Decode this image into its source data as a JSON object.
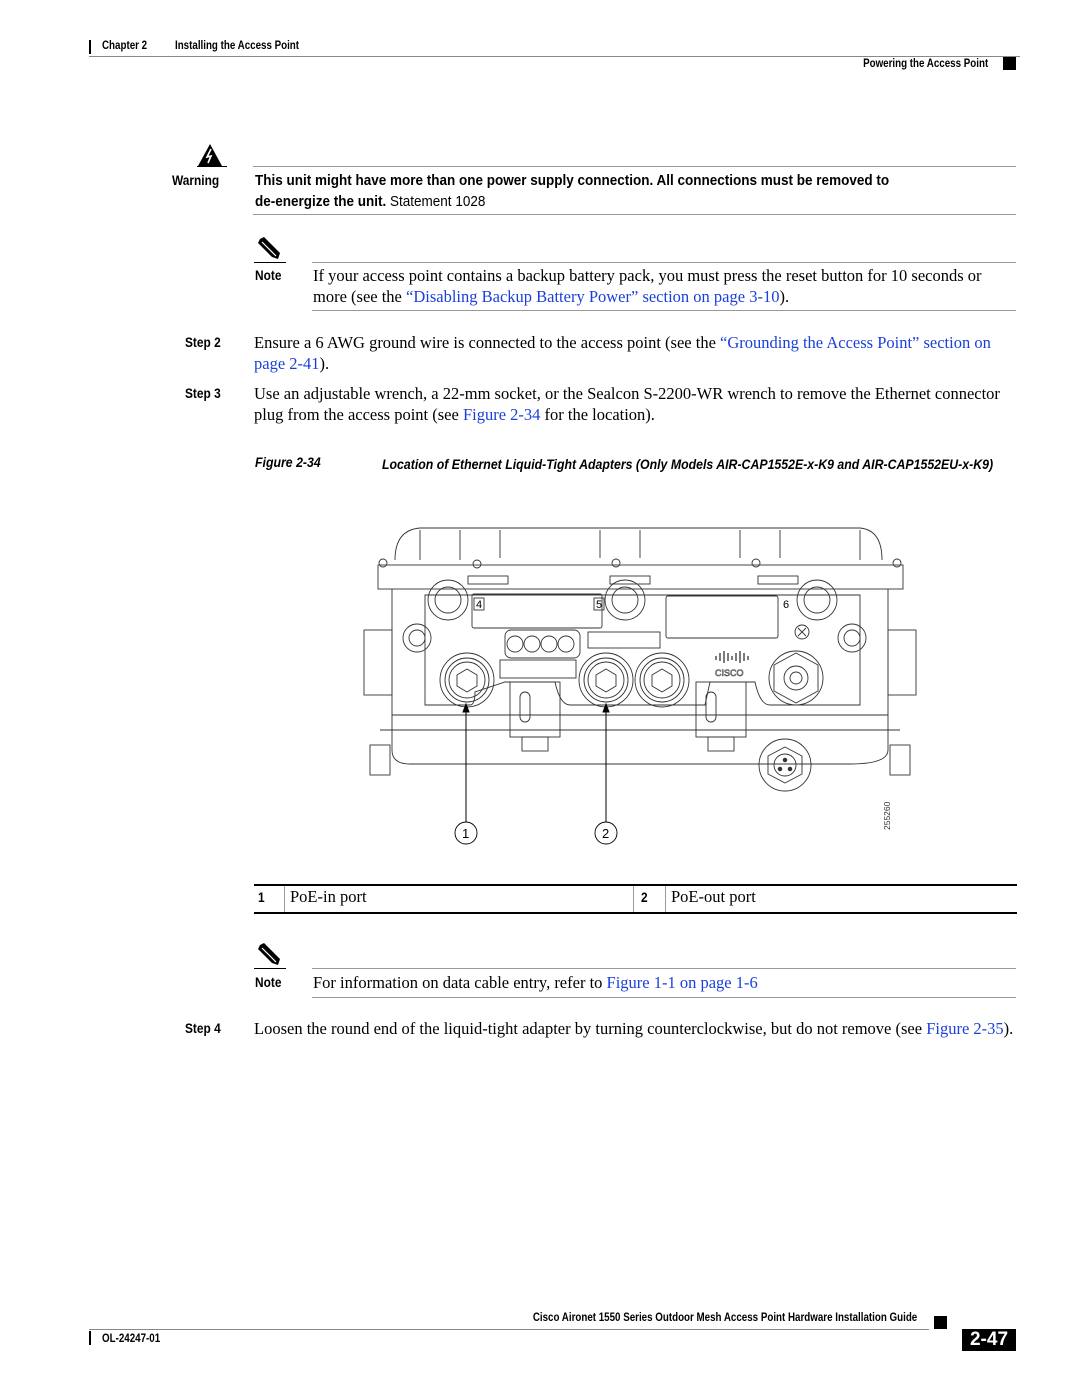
{
  "header": {
    "chapter": "Chapter 2",
    "chapter_title": "Installing the Access Point",
    "section": "Powering the Access Point"
  },
  "warning": {
    "icon": "warning-triangle-icon",
    "label": "Warning",
    "bold_text_1": "This unit might have more than one power supply connection. All connections must be removed to",
    "bold_text_2": "de-energize the unit.",
    "statement": "Statement 1028"
  },
  "note1": {
    "icon": "pencil-note-icon",
    "label": "Note",
    "text_before": "If your access point contains a backup battery pack, you must press the reset button for 10 seconds or more (see the ",
    "link": "“Disabling Backup Battery Power” section on page 3-10",
    "text_after": ")."
  },
  "steps": [
    {
      "label": "Step 2",
      "text_before": "Ensure a 6 AWG ground wire is connected to the access point (see the ",
      "link": "“Grounding the Access Point” section on page 2-41",
      "text_after": ")."
    },
    {
      "label": "Step 3",
      "text_before": "Use an adjustable wrench, a 22-mm socket, or the Sealcon S-2200-WR wrench to remove the Ethernet connector plug from the access point (see ",
      "link": "Figure 2-34",
      "text_after": " for the location)."
    },
    {
      "label": "Step 4",
      "text_before": "Loosen the round end of the liquid-tight adapter by turning counterclockwise, but do not remove (see ",
      "link": "Figure 2-35",
      "text_after": ")."
    }
  ],
  "figure": {
    "number": "Figure 2-34",
    "title": "Location of Ethernet Liquid-Tight Adapters (Only Models AIR-CAP1552E-x-K9 and AIR-CAP1552EU-x-K9)",
    "port_labels": [
      "4",
      "5",
      "6"
    ],
    "callouts": [
      "1",
      "2"
    ],
    "logo_text": "CISCO",
    "figure_id": "255260"
  },
  "legend": [
    {
      "num": "1",
      "text": "PoE-in port"
    },
    {
      "num": "2",
      "text": "PoE-out port"
    }
  ],
  "note2": {
    "label": "Note",
    "text_before": "For information on data cable entry, refer to ",
    "link": "Figure 1-1 on page 1-6",
    "text_after": ""
  },
  "footer": {
    "guide_title": "Cisco Aironet 1550 Series Outdoor Mesh Access Point Hardware Installation Guide",
    "doc_number": "OL-24247-01",
    "page": "2-47"
  }
}
